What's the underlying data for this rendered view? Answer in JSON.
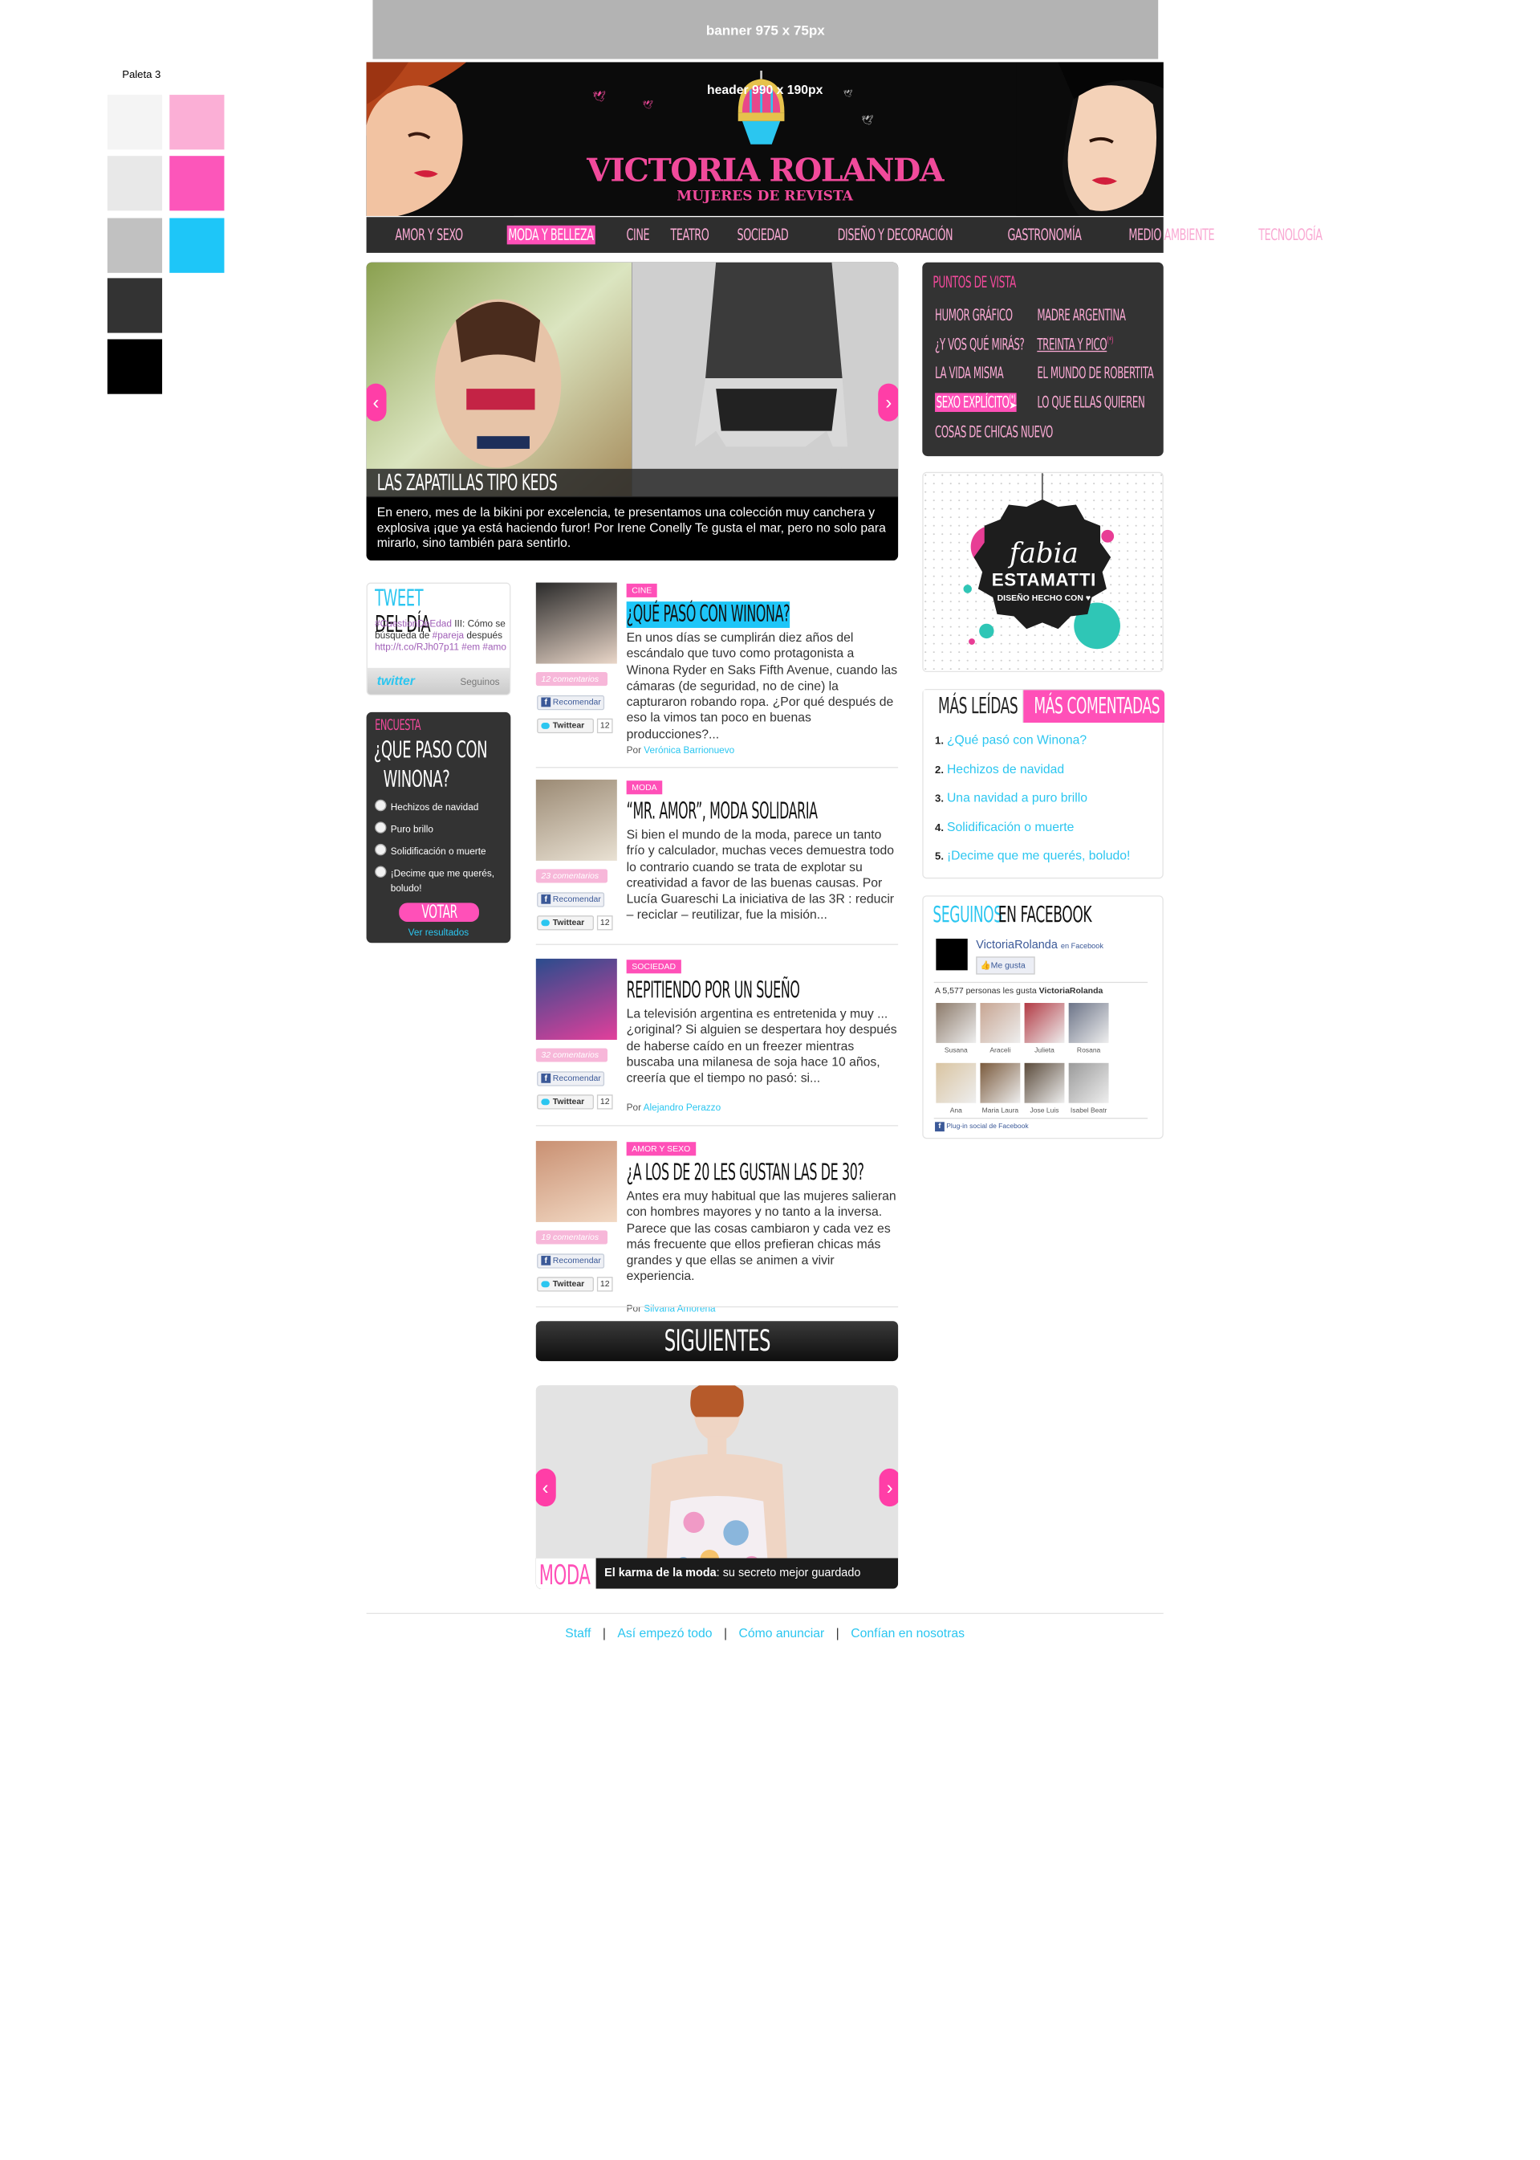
{
  "palette": {
    "label": "Paleta 3",
    "colors": [
      "#f4f4f4",
      "#fbafd6",
      "#e8e8e8",
      "#fc56ba",
      "#c1c1c1",
      "#1ec6f8",
      "#333333",
      "#000000"
    ]
  },
  "banner": {
    "text": "banner 975 x 75px"
  },
  "header": {
    "note": "header 990 x 190px",
    "logo": "VICTORIA ROLANDA",
    "tagline": "MUJERES DE REVISTA"
  },
  "nav": {
    "items": [
      "AMOR Y SEXO",
      "MODA Y BELLEZA",
      "CINE",
      "TEATRO",
      "SOCIEDAD",
      "DISEÑO Y DECORACIÓN",
      "GASTRONOMÍA",
      "MEDIO AMBIENTE",
      "TECNOLOGÍA"
    ],
    "active": "MODA Y BELLEZA"
  },
  "slider": {
    "title": "LAS ZAPATILLAS TIPO KEDS",
    "text": "En enero, mes de la bikini por excelencia, te presentamos una colección muy canchera y explosiva ¡que ya está haciendo furor! Por Irene Conelly Te gusta el mar, pero no solo para mirarlo, sino también para sentirlo.",
    "prev": "‹",
    "next": "›"
  },
  "puntos": {
    "heading": "PUNTOS DE VISTA",
    "left": [
      "HUMOR GRÁFICO",
      "¿Y VOS QUÉ MIRÁS?",
      "LA VIDA MISMA",
      "SEXO EXPLÍCITO",
      "COSAS DE CHICAS NUEVO"
    ],
    "right": [
      "MADRE ARGENTINA",
      "TREINTA Y PICO",
      "EL MUNDO DE ROBERTITA",
      "LO QUE ELLAS QUIEREN"
    ],
    "mark": "(*)"
  },
  "ad": {
    "line1": "fabia",
    "line2": "ESTAMATTI",
    "line3": "DISEÑO HECHO CON"
  },
  "tabs": {
    "leidas": "MÁS LEÍDAS",
    "comentadas": "MÁS COMENTADAS"
  },
  "ranking": [
    {
      "n": "1.",
      "t": "¿Qué pasó con Winona?"
    },
    {
      "n": "2.",
      "t": "Hechizos de navidad"
    },
    {
      "n": "3.",
      "t": "Una navidad a puro brillo"
    },
    {
      "n": "4.",
      "t": "Solidificación o muerte"
    },
    {
      "n": "5.",
      "t": "¡Decime que me querés, boludo!"
    }
  ],
  "facebook": {
    "heading_a": "SEGUINOS",
    "heading_b": "EN FACEBOOK",
    "page": "VictoriaRolanda",
    "on_fb": "en Facebook",
    "like": "Me gusta",
    "count_text": "A 5,577 personas les gusta",
    "count_page": "VictoriaRolanda",
    "people": [
      "Susana",
      "Araceli",
      "Julieta",
      "Rosana",
      "Ana",
      "Maria Laura",
      "Jose Luis",
      "Isabel Beatr"
    ],
    "plugin": "Plug-in social de Facebook"
  },
  "tweet": {
    "title_a": "TWEET",
    "title_b": "DEL DÍA",
    "line1_tag": "#CuestionDeEdad",
    "line1_rest": " III: Cómo se",
    "line2_a": "búsqueda de ",
    "line2_tag": "#pareja",
    "line2_b": " después",
    "line3": "http://t.co/RJh07p11 #em #amo",
    "brand": "twitter",
    "follow": "Seguinos"
  },
  "poll": {
    "label": "ENCUESTA",
    "q1": "¿QUE PASO CON",
    "q2": "WINONA?",
    "options": [
      "Hechizos de navidad",
      "Puro brillo",
      "Solidificación o muerte",
      "¡Decime que me querés, boludo!"
    ],
    "vote": "VOTAR",
    "results": "Ver resultados"
  },
  "articles": [
    {
      "tag": "CINE",
      "title": "¿QUÉ PASÓ CON WINONA?",
      "text": "En unos días se cumplirán diez años del escándalo que tuvo como protagonista a Winona Ryder en Saks Fifth Avenue, cuando las cámaras (de seguridad, no de cine) la capturaron robando ropa. ¿Por qué después de eso la vimos tan poco en buenas producciones?...",
      "by": "Por ",
      "author": "Verónica Barrionuevo",
      "comments": "12 comentarios",
      "fb": "Recomendar",
      "tw": "Twittear",
      "twcount": "12"
    },
    {
      "tag": "MODA",
      "title": "“MR. AMOR”, MODA SOLIDARIA",
      "text": "Si bien el mundo de la moda, parece un tanto frío y calculador, muchas veces demuestra todo lo contrario cuando se trata de explotar su creatividad a favor de las buenas causas. Por Lucía Guareschi La iniciativa de las 3R : reducir – reciclar – reutilizar, fue la misión...",
      "by": "",
      "author": "",
      "comments": "23 comentarios",
      "fb": "Recomendar",
      "tw": "Twittear",
      "twcount": "12"
    },
    {
      "tag": "SOCIEDAD",
      "title": "REPITIENDO POR UN SUEÑO",
      "text": "La televisión argentina es entretenida y muy ... ¿original? Si alguien se despertara hoy después de haberse caído en un freezer mientras buscaba una milanesa de soja hace 10 años, creería que el tiempo no pasó: si...",
      "by": "Por ",
      "author": "Alejandro Perazzo",
      "comments": "32 comentarios",
      "fb": "Recomendar",
      "tw": "Twittear",
      "twcount": "12"
    },
    {
      "tag": "AMOR Y SEXO",
      "title": "¿A LOS DE 20 LES GUSTAN LAS DE 30?",
      "text": "Antes era muy habitual que las mujeres salieran con hombres mayores y no tanto a la inversa. Parece que las cosas cambiaron y cada vez es más frecuente que ellos prefieran chicas más grandes y que ellas se animen a vivir experiencia.",
      "by": "Por ",
      "author": "Silvana Amorena",
      "comments": "19 comentarios",
      "fb": "Recomendar",
      "tw": "Twittear",
      "twcount": "12"
    }
  ],
  "siguientes": {
    "label": "SIGUIENTES",
    "badge": "MODA",
    "caption_bold": "El karma de la moda",
    "caption_rest": ": su secreto mejor guardado",
    "prev": "‹",
    "next": "›"
  },
  "footer": {
    "links": [
      "Staff",
      "Así empezó todo",
      "Cómo anunciar",
      "Confían en nosotras"
    ],
    "sep": "|"
  }
}
